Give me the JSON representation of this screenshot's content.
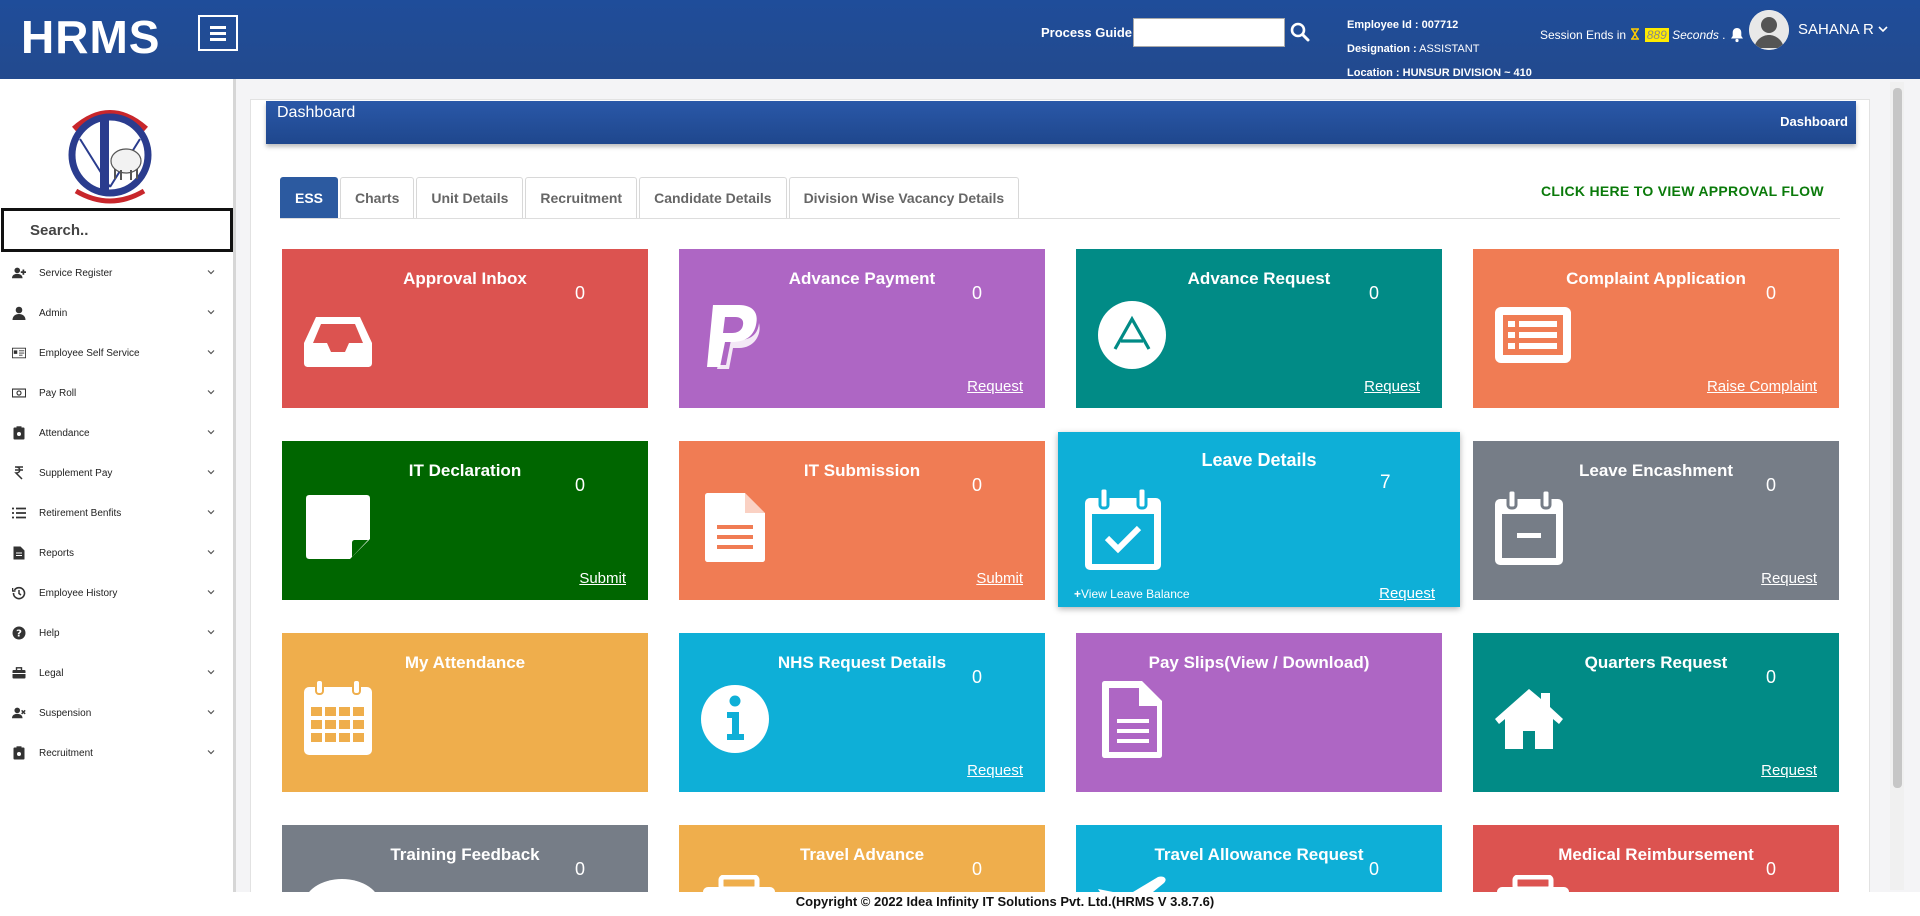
{
  "header": {
    "brand": "HRMS",
    "process_guide_label": "Process Guide:",
    "employee_id_label": "Employee Id :",
    "employee_id": "007712",
    "designation_label": "Designation :",
    "designation": "ASSISTANT",
    "location_label": "Location :",
    "location": "HUNSUR DIVISION ~ 410",
    "session_prefix": "Session Ends in",
    "session_count": "889",
    "session_suffix": "Seconds",
    "session_dot": ".",
    "username": "SAHANA R"
  },
  "sidebar": {
    "search_placeholder": "Search..",
    "items": [
      {
        "label": "Service Register",
        "icon": "user-plus-icon"
      },
      {
        "label": "Admin",
        "icon": "user-icon"
      },
      {
        "label": "Employee Self Service",
        "icon": "id-card-icon"
      },
      {
        "label": "Pay Roll",
        "icon": "money-icon"
      },
      {
        "label": "Attendance",
        "icon": "clipboard-icon"
      },
      {
        "label": "Supplement Pay",
        "icon": "rupee-icon"
      },
      {
        "label": "Retirement Benfits",
        "icon": "list-icon"
      },
      {
        "label": "Reports",
        "icon": "file-icon"
      },
      {
        "label": "Employee History",
        "icon": "history-icon"
      },
      {
        "label": "Help",
        "icon": "question-icon"
      },
      {
        "label": "Legal",
        "icon": "briefcase-icon"
      },
      {
        "label": "Suspension",
        "icon": "user-times-icon"
      },
      {
        "label": "Recruitment",
        "icon": "clipboard-icon"
      }
    ]
  },
  "breadcrumb": {
    "title": "Dashboard",
    "current": "Dashboard"
  },
  "tabs": [
    {
      "label": "ESS",
      "active": true
    },
    {
      "label": "Charts",
      "active": false
    },
    {
      "label": "Unit Details",
      "active": false
    },
    {
      "label": "Recruitment",
      "active": false
    },
    {
      "label": "Candidate Details",
      "active": false
    },
    {
      "label": "Division Wise Vacancy Details",
      "active": false
    }
  ],
  "approval_flow_link": "CLICK HERE TO VIEW APPROVAL FLOW",
  "colors": {
    "red": "#dc5350",
    "purple": "#ae66c4",
    "teal": "#018b86",
    "orange": "#f07c54",
    "green": "#006600",
    "cyan": "#0eafd7",
    "gray": "#767d87",
    "amber": "#efae4c",
    "header": "#234a8e"
  },
  "tiles": [
    {
      "title": "Approval Inbox",
      "count": "0",
      "link": "",
      "icon": "inbox-icon"
    },
    {
      "title": "Advance Payment",
      "count": "0",
      "link": "Request",
      "icon": "paypal-icon"
    },
    {
      "title": "Advance Request",
      "count": "0",
      "link": "Request",
      "icon": "a-circle-icon"
    },
    {
      "title": "Complaint Application",
      "count": "0",
      "link": "Raise Complaint",
      "icon": "list-alt-icon"
    },
    {
      "title": "IT Declaration",
      "count": "0",
      "link": "Submit",
      "icon": "sticky-note-icon"
    },
    {
      "title": "IT Submission",
      "count": "0",
      "link": "Submit",
      "icon": "file-text-icon"
    },
    {
      "title": "Leave Details",
      "count": "7",
      "link": "Request",
      "sublink": "View Leave Balance",
      "icon": "calendar-check-icon"
    },
    {
      "title": "Leave Encashment",
      "count": "0",
      "link": "Request",
      "icon": "calendar-minus-icon"
    },
    {
      "title": "My Attendance",
      "count": "",
      "link": "",
      "icon": "calendar-grid-icon"
    },
    {
      "title": "NHS Request Details",
      "count": "0",
      "link": "Request",
      "icon": "info-circle-icon"
    },
    {
      "title": "Pay Slips(View / Download)",
      "count": "",
      "link": "",
      "icon": "document-icon"
    },
    {
      "title": "Quarters Request",
      "count": "0",
      "link": "Request",
      "icon": "home-icon"
    },
    {
      "title": "Training Feedback",
      "count": "0",
      "link": "",
      "icon": "comment-icon"
    },
    {
      "title": "Travel Advance",
      "count": "0",
      "link": "",
      "icon": "suitcase-icon"
    },
    {
      "title": "Travel Allowance Request",
      "count": "0",
      "link": "",
      "icon": "plane-icon"
    },
    {
      "title": "Medical Reimbursement",
      "count": "0",
      "link": "",
      "icon": "medkit-icon"
    }
  ],
  "footer": "Copyright © 2022 Idea Infinity IT Solutions Pvt. Ltd.(HRMS V 3.8.7.6)"
}
